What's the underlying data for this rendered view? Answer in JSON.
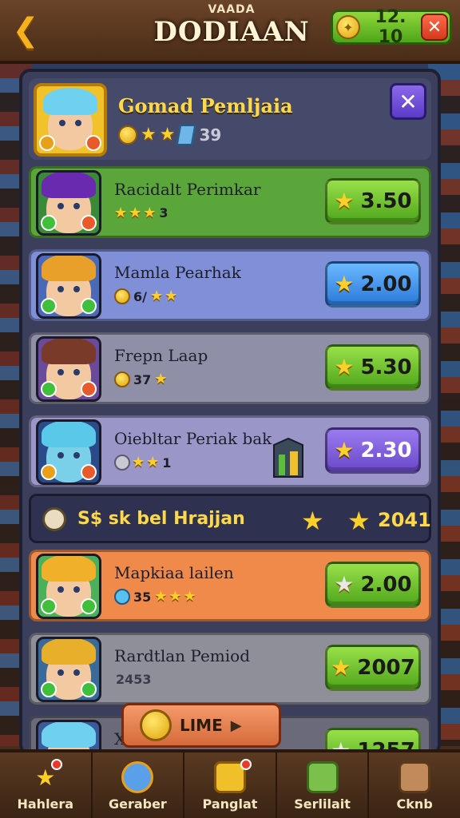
{
  "topbar": {
    "subtitle": "VAADA",
    "title": "DODIAAN",
    "currency_value": "12. 10"
  },
  "header": {
    "name": "Gomad Pemljaia",
    "stat_value": "39"
  },
  "rows": [
    {
      "name": "Racidalt Perimkar",
      "sub_value": "3",
      "price": "3.50",
      "button_color": "green",
      "bg": "#5aa63a"
    },
    {
      "name": "Mamla Pearhak",
      "sub_value": "6/",
      "price": "2.00",
      "button_color": "blue",
      "bg": "#7f8fd8"
    },
    {
      "name": "Frepn Laap",
      "sub_value": "37",
      "price": "5.30",
      "button_color": "green",
      "bg": "#8f8fa8"
    },
    {
      "name": "Oiebltar Periak bak",
      "sub_value": "1",
      "price": "2.30",
      "button_color": "purple",
      "bg": "#9a96c8"
    },
    {
      "name": "Mapkiaa lailen",
      "sub_value": "35",
      "price": "2.00",
      "button_color": "green",
      "bg": "#f08a4a"
    },
    {
      "name": "Rardtlan Pemiod",
      "sub_value": "2453",
      "price": "2007",
      "button_color": "green",
      "bg": "#8f8f9a"
    },
    {
      "name": "X",
      "sub_value": "",
      "price": "1257",
      "button_color": "green",
      "bg": "#6a6a7a"
    }
  ],
  "bonus": {
    "text": "S$ sk bel Hrajjan",
    "value": "2041"
  },
  "overlay": {
    "label": "LIME"
  },
  "nav": [
    {
      "label": "Hahlera",
      "icon": "star-icon",
      "dot": true
    },
    {
      "label": "Geraber",
      "icon": "magnifier-icon",
      "dot": false
    },
    {
      "label": "Panglat",
      "icon": "chest-icon",
      "dot": true
    },
    {
      "label": "Serlilait",
      "icon": "scroll-icon",
      "dot": false
    },
    {
      "label": "Cknb",
      "icon": "camera-icon",
      "dot": false
    }
  ],
  "colors": {
    "accent_gold": "#ffd94a",
    "btn_green": "#4ea51a",
    "btn_blue": "#2a78d8",
    "btn_purple": "#6a48c8"
  }
}
